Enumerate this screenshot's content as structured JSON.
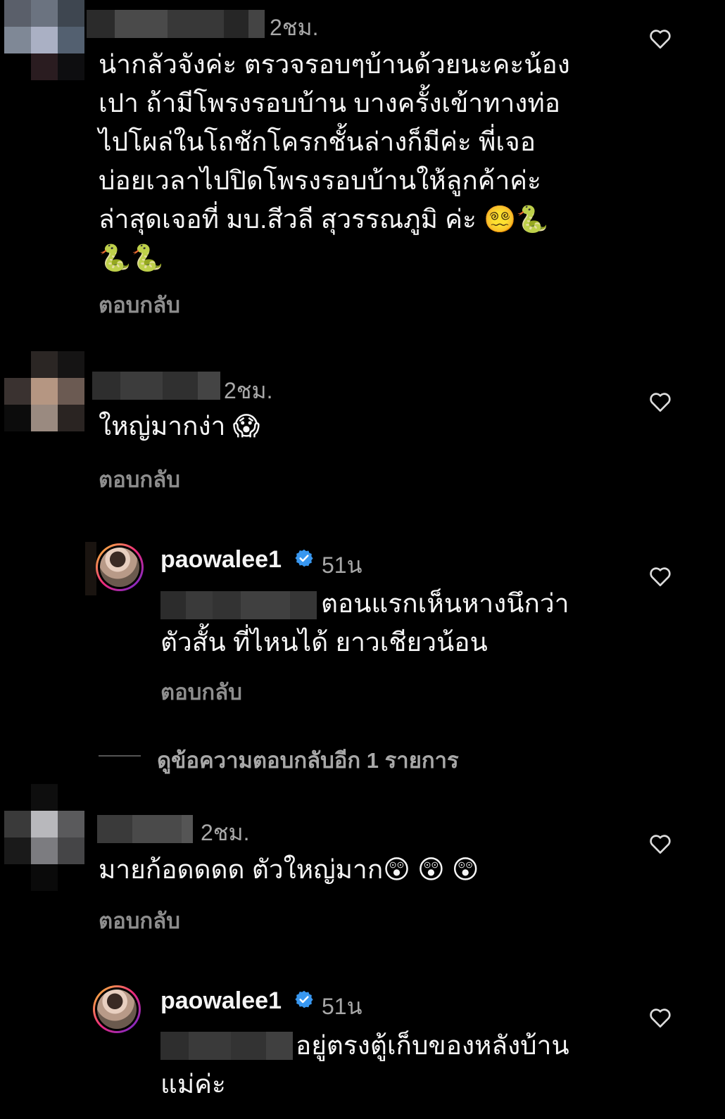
{
  "comments": [
    {
      "time": "2ชม.",
      "text": "น่ากลัวจังค่ะ ตรวจรอบๆบ้านด้วยนะคะน้อง\nเปา ถ้ามีโพรงรอบบ้าน บางครั้งเข้าทางท่อ\nไปโผล่ในโถชักโครกชั้นล่างก็มีค่ะ พี่เจอ\nบ่อยเวลาไปปิดโพรงรอบบ้านให้ลูกค้าค่ะ\nล่าสุดเจอที่ มบ.สีวลี สุวรรณภูมิ ค่ะ 😵‍💫🐍\n🐍🐍",
      "reply_label": "ตอบกลับ"
    },
    {
      "time": "2ชม.",
      "text": "ใหญ่มากง่า 😱",
      "reply_label": "ตอบกลับ"
    },
    {
      "username": "paowalee1",
      "verified": true,
      "time": "51น",
      "text": "ตอนแรกเห็นหางนึกว่า\nตัวสั้น ที่ไหนได้ ยาวเชียวน้อน",
      "reply_label": "ตอบกลับ"
    },
    {
      "time": "2ชม.",
      "text": "มายก้อดดดด ตัวใหญ่มาก😲 😲 😲",
      "reply_label": "ตอบกลับ"
    },
    {
      "username": "paowalee1",
      "verified": true,
      "time": "51น",
      "text": "อยู่ตรงตู้เก็บของหลังบ้าน\nแม่ค่ะ"
    }
  ],
  "view_more_replies": "ดูข้อความตอบกลับอีก 1 รายการ",
  "icons": {
    "like": "heart-outline-icon",
    "verified": "verified-badge-icon"
  },
  "colors": {
    "background": "#000000",
    "text": "#f5f5f5",
    "muted": "#8e8e8e",
    "verified": "#3897f0"
  }
}
